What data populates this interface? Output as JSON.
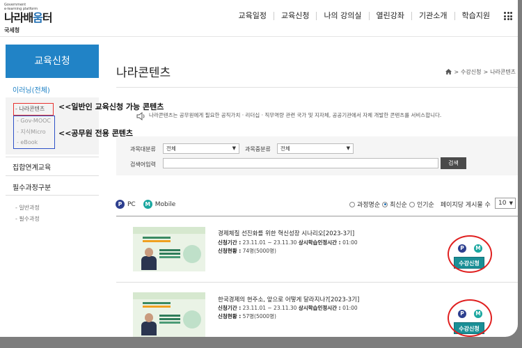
{
  "header": {
    "logo_line1": "Government",
    "logo_line2": "e-learning platform",
    "logo_main_a": "나라배",
    "logo_main_b": "움",
    "logo_main_c": "터",
    "logo_sub": "국세청",
    "nav": [
      "교육일정",
      "교육신청",
      "나의 강의실",
      "열린강좌",
      "기관소개",
      "학습지원"
    ]
  },
  "sidebar": {
    "title": "교육신청",
    "category": "이러닝(전체)",
    "sub_items": [
      "- 나라콘텐츠",
      "- Gov-MOOC",
      "- 지식Micro",
      "- eBook"
    ],
    "sections": [
      "집합연계교육",
      "필수과정구분"
    ],
    "small_items": [
      "- 일반과정",
      "- 필수과정"
    ]
  },
  "annotations": {
    "general": "<<일반인 교육신청 가능 콘텐츠",
    "officials": "<<공무원 전용 콘텐츠"
  },
  "main": {
    "title": "나라콘텐츠",
    "breadcrumb": [
      "수강신청",
      "나라콘텐츠"
    ],
    "intro": "나라콘텐츠는 공무원에게 필요한 공직가치 · 리더십 · 직무역량 관련 국가 및 지자체, 공공기관에서 자체 개발한 콘텐츠를 서비스합니다."
  },
  "filter": {
    "major_label": "과목대분류",
    "major_value": "전체",
    "mid_label": "과목중분류",
    "mid_value": "전체",
    "search_label": "검색어입력",
    "search_value": "",
    "search_button": "검색"
  },
  "list_controls": {
    "pc_badge": "P",
    "pc_label": "PC",
    "mobile_badge": "M",
    "mobile_label": "Mobile",
    "sort_options": [
      "과정명순",
      "최신순",
      "인기순"
    ],
    "sort_selected": "최신순",
    "per_page_label": "페이지당 게시물 수",
    "per_page_value": "10"
  },
  "courses": [
    {
      "title": "경제체질 선진화를 위한 혁신성장 시나리오[2023-3기]",
      "period_label": "신청기간 :",
      "period": "23.11.01 ~ 23.11.30",
      "hours_label": "상시학습인정시간 :",
      "hours": "01:00",
      "status_label": "신청현황 :",
      "status": "74명(5000명)",
      "badge_p": "P",
      "badge_m": "M",
      "apply_label": "수강신청"
    },
    {
      "title": "한국경제의 현주소, 앞으로 어떻게 달라지나?[2023-3기]",
      "period_label": "신청기간 :",
      "period": "23.11.01 ~ 23.11.30",
      "hours_label": "상시학습인정시간 :",
      "hours": "01:00",
      "status_label": "신청현황 :",
      "status": "57명(5000명)",
      "badge_p": "P",
      "badge_m": "M",
      "apply_label": "수강신청"
    }
  ],
  "colors": {
    "brand_blue": "#2183c6",
    "apply_teal": "#1a8f96",
    "annotation_red": "#e8302d",
    "annotation_blue": "#2c50c7"
  }
}
